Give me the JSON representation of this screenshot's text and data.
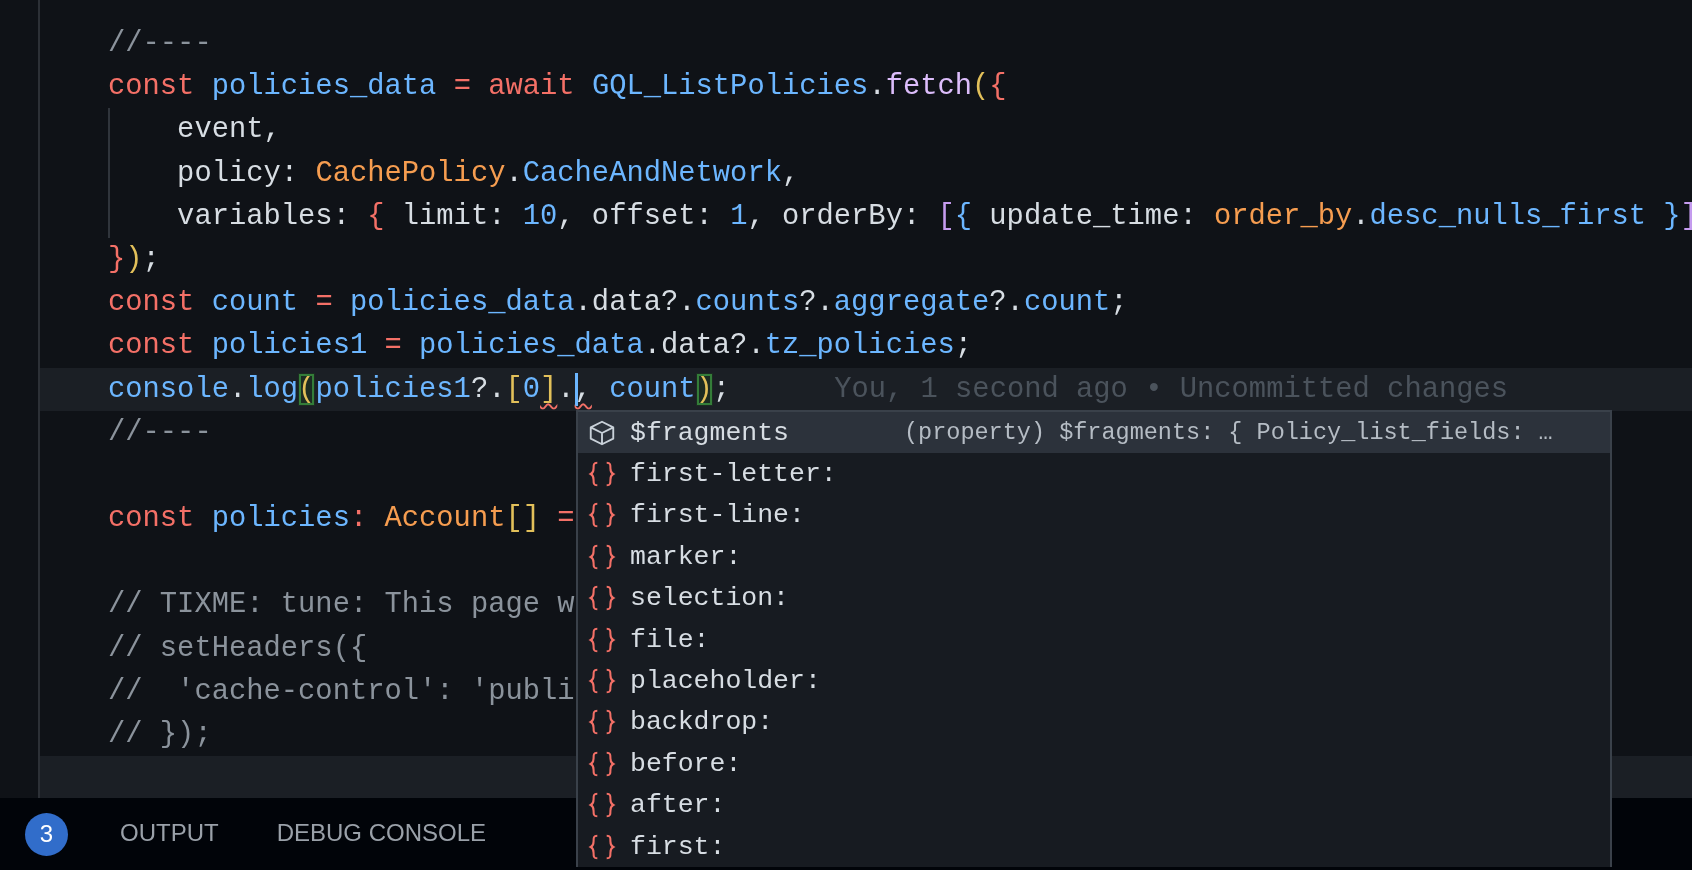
{
  "editor": {
    "lines": [
      {
        "current": false,
        "tokens": [
          {
            "t": "//----",
            "kind": "comment"
          }
        ]
      },
      {
        "current": false,
        "tokens": [
          {
            "t": "const ",
            "kind": "kw"
          },
          {
            "t": "policies_data ",
            "kind": "id"
          },
          {
            "t": "= await ",
            "kind": "kw"
          },
          {
            "t": "GQL_ListPolicies",
            "kind": "id"
          },
          {
            "t": ".",
            "kind": "plain"
          },
          {
            "t": "fetch",
            "kind": "fn"
          },
          {
            "t": "(",
            "kind": "b1"
          },
          {
            "t": "{",
            "kind": "b2"
          }
        ]
      },
      {
        "current": false,
        "tokens": [
          {
            "t": "    event,",
            "kind": "plain"
          }
        ]
      },
      {
        "current": false,
        "tokens": [
          {
            "t": "    policy: ",
            "kind": "plain"
          },
          {
            "t": "CachePolicy",
            "kind": "type"
          },
          {
            "t": ".",
            "kind": "plain"
          },
          {
            "t": "CacheAndNetwork",
            "kind": "id"
          },
          {
            "t": ",",
            "kind": "plain"
          }
        ]
      },
      {
        "current": false,
        "tokens": [
          {
            "t": "    variables: ",
            "kind": "plain"
          },
          {
            "t": "{",
            "kind": "b2"
          },
          {
            "t": " limit: ",
            "kind": "plain"
          },
          {
            "t": "10",
            "kind": "id"
          },
          {
            "t": ", offset: ",
            "kind": "plain"
          },
          {
            "t": "1",
            "kind": "id"
          },
          {
            "t": ", orderBy: ",
            "kind": "plain"
          },
          {
            "t": "[",
            "kind": "b3"
          },
          {
            "t": "{",
            "kind": "id"
          },
          {
            "t": " update_time: ",
            "kind": "plain"
          },
          {
            "t": "order_by",
            "kind": "type"
          },
          {
            "t": ".",
            "kind": "plain"
          },
          {
            "t": "desc_nulls_first ",
            "kind": "id"
          },
          {
            "t": "}",
            "kind": "id"
          },
          {
            "t": "]",
            "kind": "b3"
          }
        ]
      },
      {
        "current": false,
        "tokens": [
          {
            "t": "}",
            "kind": "b2"
          },
          {
            "t": ")",
            "kind": "b1"
          },
          {
            "t": ";",
            "kind": "plain"
          }
        ]
      },
      {
        "current": false,
        "tokens": [
          {
            "t": "const ",
            "kind": "kw"
          },
          {
            "t": "count ",
            "kind": "id"
          },
          {
            "t": "= ",
            "kind": "kw"
          },
          {
            "t": "policies_data",
            "kind": "id"
          },
          {
            "t": ".data?.",
            "kind": "plain"
          },
          {
            "t": "counts",
            "kind": "id"
          },
          {
            "t": "?.",
            "kind": "plain"
          },
          {
            "t": "aggregate",
            "kind": "id"
          },
          {
            "t": "?.",
            "kind": "plain"
          },
          {
            "t": "count",
            "kind": "id"
          },
          {
            "t": ";",
            "kind": "plain"
          }
        ]
      },
      {
        "current": false,
        "tokens": [
          {
            "t": "const ",
            "kind": "kw"
          },
          {
            "t": "policies1 ",
            "kind": "id"
          },
          {
            "t": "= ",
            "kind": "kw"
          },
          {
            "t": "policies_data",
            "kind": "id"
          },
          {
            "t": ".data?.",
            "kind": "plain"
          },
          {
            "t": "tz_policies",
            "kind": "id"
          },
          {
            "t": ";",
            "kind": "plain"
          }
        ]
      },
      {
        "current": true,
        "blame": "You, 1 second ago • Uncommitted changes",
        "tokens": [
          {
            "t": "console",
            "kind": "id"
          },
          {
            "t": ".",
            "kind": "plain"
          },
          {
            "t": "log",
            "kind": "id"
          },
          {
            "t": "(",
            "kind": "b1",
            "matched": true
          },
          {
            "t": "policies1",
            "kind": "id"
          },
          {
            "t": "?.",
            "kind": "plain"
          },
          {
            "t": "[",
            "kind": "b1"
          },
          {
            "t": "0",
            "kind": "id"
          },
          {
            "t": "]",
            "kind": "b1",
            "error": true
          },
          {
            "t": ".",
            "kind": "plain"
          },
          {
            "t": ",",
            "kind": "plain",
            "caret": true,
            "error": true
          },
          {
            "t": " count",
            "kind": "id"
          },
          {
            "t": ")",
            "kind": "b1",
            "matched": true
          },
          {
            "t": ";",
            "kind": "plain"
          }
        ]
      },
      {
        "current": false,
        "tokens": [
          {
            "t": "//----",
            "kind": "comment"
          }
        ]
      },
      {
        "current": false
      },
      {
        "current": false,
        "tokens": [
          {
            "t": "const ",
            "kind": "kw"
          },
          {
            "t": "policies",
            "kind": "id"
          },
          {
            "t": ": ",
            "kind": "kw"
          },
          {
            "t": "Account",
            "kind": "type"
          },
          {
            "t": "[]",
            "kind": "b1"
          },
          {
            "t": " =",
            "kind": "kw"
          }
        ]
      },
      {
        "current": false
      },
      {
        "current": false,
        "tokens": [
          {
            "t": "// TIXME: tune: This page w",
            "kind": "comment"
          }
        ]
      },
      {
        "current": false,
        "tokens": [
          {
            "t": "// setHeaders({",
            "kind": "comment"
          }
        ]
      },
      {
        "current": false,
        "tokens": [
          {
            "t": "//  'cache-control': 'publi",
            "kind": "comment"
          }
        ]
      },
      {
        "current": false,
        "tokens": [
          {
            "t": "// });",
            "kind": "comment"
          }
        ]
      },
      {
        "current": true
      }
    ]
  },
  "suggestions": {
    "items": [
      {
        "kind": "property",
        "label": "$fragments",
        "detail": "(property) $fragments: { Policy_list_fields: …",
        "selected": true
      },
      {
        "kind": "snippet",
        "label": "first-letter:",
        "selected": false
      },
      {
        "kind": "snippet",
        "label": "first-line:",
        "selected": false
      },
      {
        "kind": "snippet",
        "label": "marker:",
        "selected": false
      },
      {
        "kind": "snippet",
        "label": "selection:",
        "selected": false
      },
      {
        "kind": "snippet",
        "label": "file:",
        "selected": false
      },
      {
        "kind": "snippet",
        "label": "placeholder:",
        "selected": false
      },
      {
        "kind": "snippet",
        "label": "backdrop:",
        "selected": false
      },
      {
        "kind": "snippet",
        "label": "before:",
        "selected": false
      },
      {
        "kind": "snippet",
        "label": "after:",
        "selected": false
      },
      {
        "kind": "snippet",
        "label": "first:",
        "selected": false
      }
    ]
  },
  "panel": {
    "badge": "3",
    "tabs": [
      {
        "label": "OUTPUT",
        "selected": false
      },
      {
        "label": "DEBUG CONSOLE",
        "selected": false
      }
    ]
  }
}
